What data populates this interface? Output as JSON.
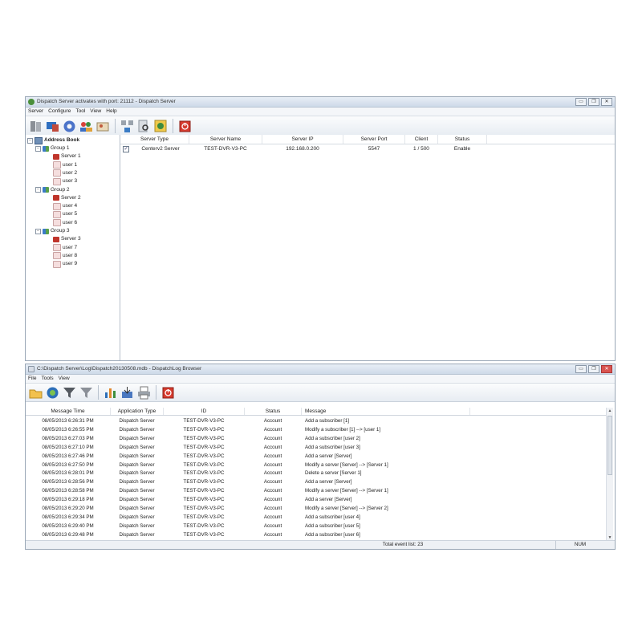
{
  "server_window": {
    "title": "Dispatch Server activates with port: 21112 - Dispatch Server",
    "controls": [
      "▭",
      "❐",
      "✕"
    ],
    "menu": [
      "Server",
      "Configure",
      "Tool",
      "View",
      "Help"
    ],
    "toolbar_icons": [
      "server-stack-icon",
      "monitor-icon",
      "gear-icon",
      "users-icon",
      "user-card-icon",
      "network-icon",
      "search-doc-icon",
      "log-icon",
      "power-icon"
    ],
    "tree": {
      "root": "Address Book",
      "groups": [
        {
          "label": "Group 1",
          "children": [
            {
              "label": "Server 1",
              "kind": "server"
            },
            {
              "label": "user 1",
              "kind": "user"
            },
            {
              "label": "user 2",
              "kind": "user"
            },
            {
              "label": "user 3",
              "kind": "user"
            }
          ]
        },
        {
          "label": "Group 2",
          "children": [
            {
              "label": "Server 2",
              "kind": "server"
            },
            {
              "label": "user 4",
              "kind": "user"
            },
            {
              "label": "user 5",
              "kind": "user"
            },
            {
              "label": "user 6",
              "kind": "user"
            }
          ]
        },
        {
          "label": "Group 3",
          "children": [
            {
              "label": "Server 3",
              "kind": "server"
            },
            {
              "label": "user 7",
              "kind": "user"
            },
            {
              "label": "user 8",
              "kind": "user"
            },
            {
              "label": "user 9",
              "kind": "user"
            }
          ]
        }
      ]
    },
    "table": {
      "headers": [
        "Server Type",
        "Server Name",
        "Server IP",
        "Server Port",
        "Client",
        "Status"
      ],
      "rows": [
        {
          "checked": true,
          "cells": [
            "Centerv2 Server",
            "TEST-DVR-V3-PC",
            "192.168.0.200",
            "5547",
            "1 / 500",
            "Enable"
          ]
        }
      ]
    }
  },
  "log_window": {
    "title": "C:\\Dispatch Server\\Log\\Dispatch20130508.mdb - DispatchLog Browser",
    "controls": [
      "▭",
      "❐",
      "✕"
    ],
    "menu": [
      "File",
      "Tools",
      "View"
    ],
    "toolbar_icons": [
      "folder-icon",
      "refresh-icon",
      "filter-icon",
      "filter-settings-icon",
      "chart-icon",
      "export-icon",
      "print-icon",
      "power-icon"
    ],
    "headers": [
      "Message Time",
      "Application Type",
      "ID",
      "Status",
      "Message"
    ],
    "rows": [
      [
        "08/05/2013 6:26:31 PM",
        "Dispatch Server",
        "TEST-DVR-V3-PC",
        "Account",
        "Add a subscriber [1]"
      ],
      [
        "08/05/2013 6:26:55 PM",
        "Dispatch Server",
        "TEST-DVR-V3-PC",
        "Account",
        "Modify a subscriber [1] --> [user 1]"
      ],
      [
        "08/05/2013 6:27:03 PM",
        "Dispatch Server",
        "TEST-DVR-V3-PC",
        "Account",
        "Add a subscriber [user 2]"
      ],
      [
        "08/05/2013 6:27:10 PM",
        "Dispatch Server",
        "TEST-DVR-V3-PC",
        "Account",
        "Add a subscriber [user 3]"
      ],
      [
        "08/05/2013 6:27:46 PM",
        "Dispatch Server",
        "TEST-DVR-V3-PC",
        "Account",
        "Add a server [Server]"
      ],
      [
        "08/05/2013 6:27:50 PM",
        "Dispatch Server",
        "TEST-DVR-V3-PC",
        "Account",
        "Modify a server [Server] --> [Server 1]"
      ],
      [
        "08/05/2013 6:28:01 PM",
        "Dispatch Server",
        "TEST-DVR-V3-PC",
        "Account",
        "Delete a server [Server 1]"
      ],
      [
        "08/05/2013 6:28:56 PM",
        "Dispatch Server",
        "TEST-DVR-V3-PC",
        "Account",
        "Add a server [Server]"
      ],
      [
        "08/05/2013 6:28:58 PM",
        "Dispatch Server",
        "TEST-DVR-V3-PC",
        "Account",
        "Modify a server [Server] --> [Server 1]"
      ],
      [
        "08/05/2013 6:29:18 PM",
        "Dispatch Server",
        "TEST-DVR-V3-PC",
        "Account",
        "Add a server [Server]"
      ],
      [
        "08/05/2013 6:29:20 PM",
        "Dispatch Server",
        "TEST-DVR-V3-PC",
        "Account",
        "Modify a server [Server] --> [Server 2]"
      ],
      [
        "08/05/2013 6:29:34 PM",
        "Dispatch Server",
        "TEST-DVR-V3-PC",
        "Account",
        "Add a subscriber [user 4]"
      ],
      [
        "08/05/2013 6:29:40 PM",
        "Dispatch Server",
        "TEST-DVR-V3-PC",
        "Account",
        "Add a subscriber [user 5]"
      ],
      [
        "08/05/2013 6:29:48 PM",
        "Dispatch Server",
        "TEST-DVR-V3-PC",
        "Account",
        "Add a subscriber [user 6]"
      ]
    ],
    "status_total": "Total event list: 23",
    "status_num": "NUM"
  },
  "colors": {
    "titlebar": "#cdd9e8",
    "close_button": "#d9534f",
    "server_red": "#c0352b"
  }
}
